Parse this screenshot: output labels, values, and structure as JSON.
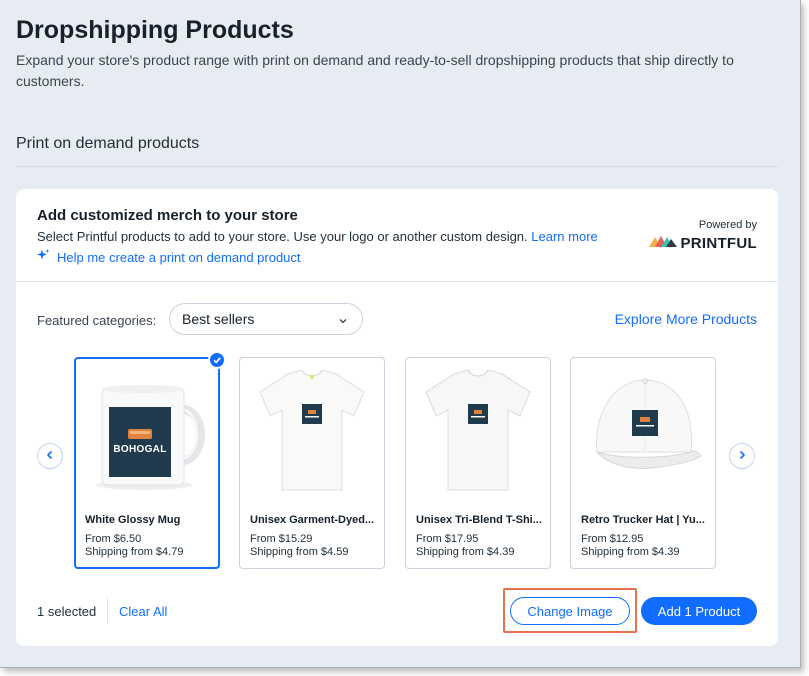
{
  "page": {
    "title": "Dropshipping Products",
    "subtitle": "Expand your store's product range with print on demand and ready-to-sell dropshipping products that ship directly to customers."
  },
  "section": {
    "title": "Print on demand products"
  },
  "card": {
    "title": "Add customized merch to your store",
    "description": "Select Printful products to add to your store. Use your logo or another custom design.",
    "learn_more": "Learn more",
    "help_link": "Help me create a print on demand product",
    "powered_by": "Powered by",
    "brand": "PRINTFUL"
  },
  "filters": {
    "featured_label": "Featured categories:",
    "selected_category": "Best sellers",
    "explore_link": "Explore More Products"
  },
  "logo_text": "BOHOGAL",
  "products": [
    {
      "name": "White Glossy Mug",
      "price": "From $6.50",
      "shipping": "Shipping from $4.79",
      "selected": true,
      "icon": "mug-image"
    },
    {
      "name": "Unisex Garment-Dyed...",
      "price": "From $15.29",
      "shipping": "Shipping from $4.59",
      "selected": false,
      "icon": "tshirt-image"
    },
    {
      "name": "Unisex Tri-Blend T-Shi...",
      "price": "From $17.95",
      "shipping": "Shipping from $4.39",
      "selected": false,
      "icon": "tshirt-image"
    },
    {
      "name": "Retro Trucker Hat | Yu...",
      "price": "From $12.95",
      "shipping": "Shipping from $4.39",
      "selected": false,
      "icon": "hat-image"
    }
  ],
  "footer": {
    "selected_count": "1 selected",
    "clear_all": "Clear All",
    "change_image": "Change Image",
    "add_button": "Add 1 Product"
  },
  "colors": {
    "accent": "#116dff",
    "background": "#e7ebf2",
    "highlight": "#e8704d"
  }
}
